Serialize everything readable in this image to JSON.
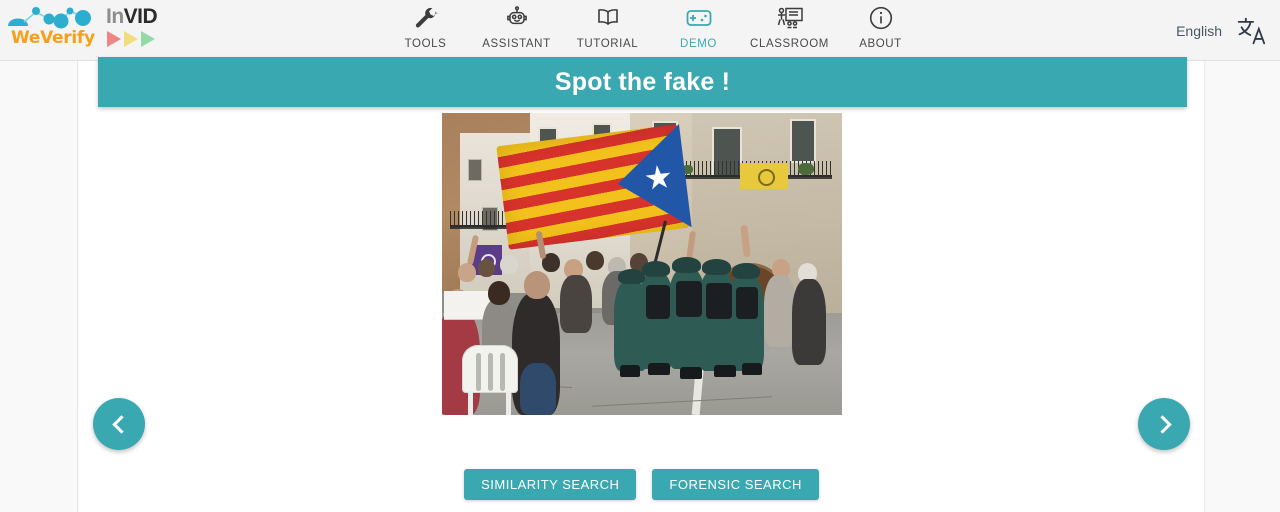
{
  "header": {
    "brand_primary": "WeVerify",
    "brand_secondary_part1": "In",
    "brand_secondary_part2": "VID",
    "brand_primary_color": "#f6a01a",
    "accent_color": "#3aa8b0",
    "nav": [
      {
        "label": "TOOLS",
        "icon": "wrench-icon",
        "active": false
      },
      {
        "label": "ASSISTANT",
        "icon": "robot-icon",
        "active": false
      },
      {
        "label": "TUTORIAL",
        "icon": "book-icon",
        "active": false
      },
      {
        "label": "DEMO",
        "icon": "gamepad-icon",
        "active": true
      },
      {
        "label": "CLASSROOM",
        "icon": "classroom-icon",
        "active": false
      },
      {
        "label": "ABOUT",
        "icon": "info-icon",
        "active": false
      }
    ],
    "language_label": "English",
    "language_icon": "translate-icon"
  },
  "main": {
    "banner_title": "Spot the fake !",
    "image_alt": "Crowd with Catalan Estelada flag confronted by Guardia Civil officers in a village street",
    "prev_label": "Previous",
    "next_label": "Next",
    "buttons": [
      {
        "label": "SIMILARITY SEARCH"
      },
      {
        "label": "FORENSIC SEARCH"
      }
    ]
  }
}
